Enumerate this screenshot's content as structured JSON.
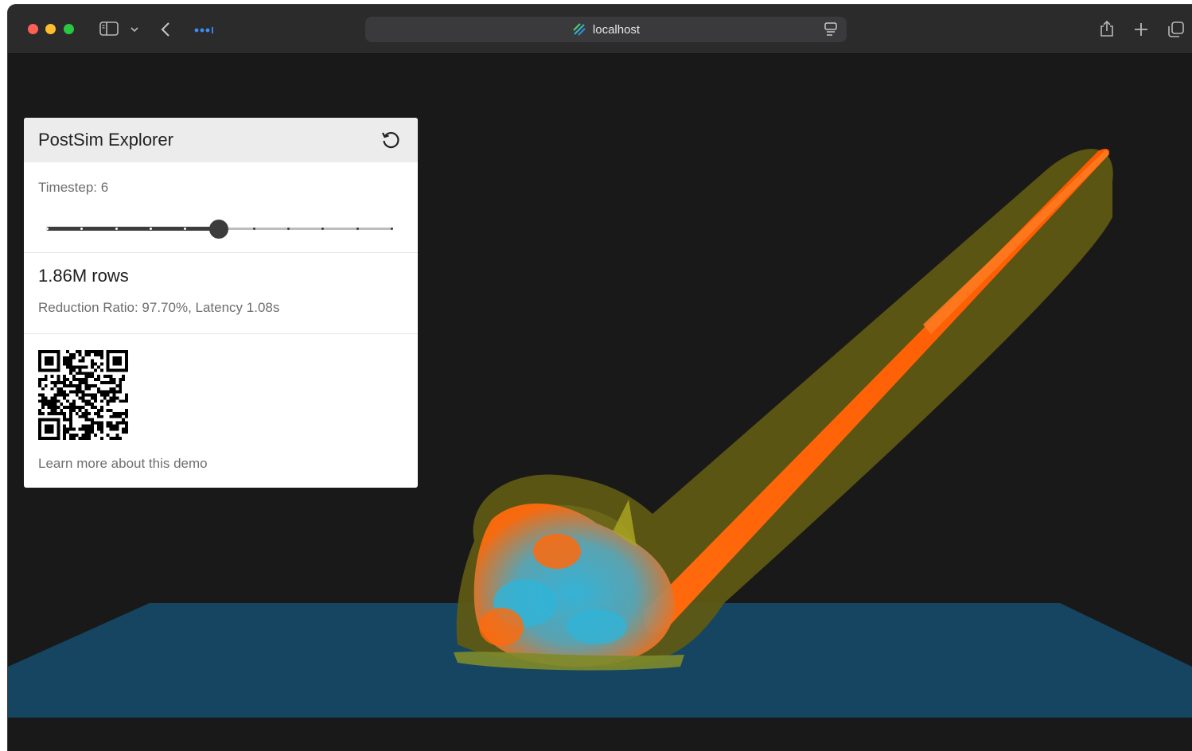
{
  "browser": {
    "url": "localhost",
    "window_title": "localhost"
  },
  "panel": {
    "title": "PostSim Explorer",
    "reset_icon": "rotate-ccw-icon",
    "timestep": {
      "label": "Timestep: 6",
      "value": 6,
      "min": 1,
      "max": 11,
      "step_count": 11
    },
    "stats": {
      "rows": "1.86M rows",
      "details": "Reduction Ratio: 97.70%, Latency 1.08s"
    },
    "qr_icon": "qr-code",
    "learn_more": "Learn more about this demo"
  },
  "scene": {
    "ground_color": "#154561",
    "plume_color": "#4f4b14",
    "jet_color": "#ff6a0d",
    "splash_color": "#2fb4d8",
    "background_color": "#191919"
  }
}
